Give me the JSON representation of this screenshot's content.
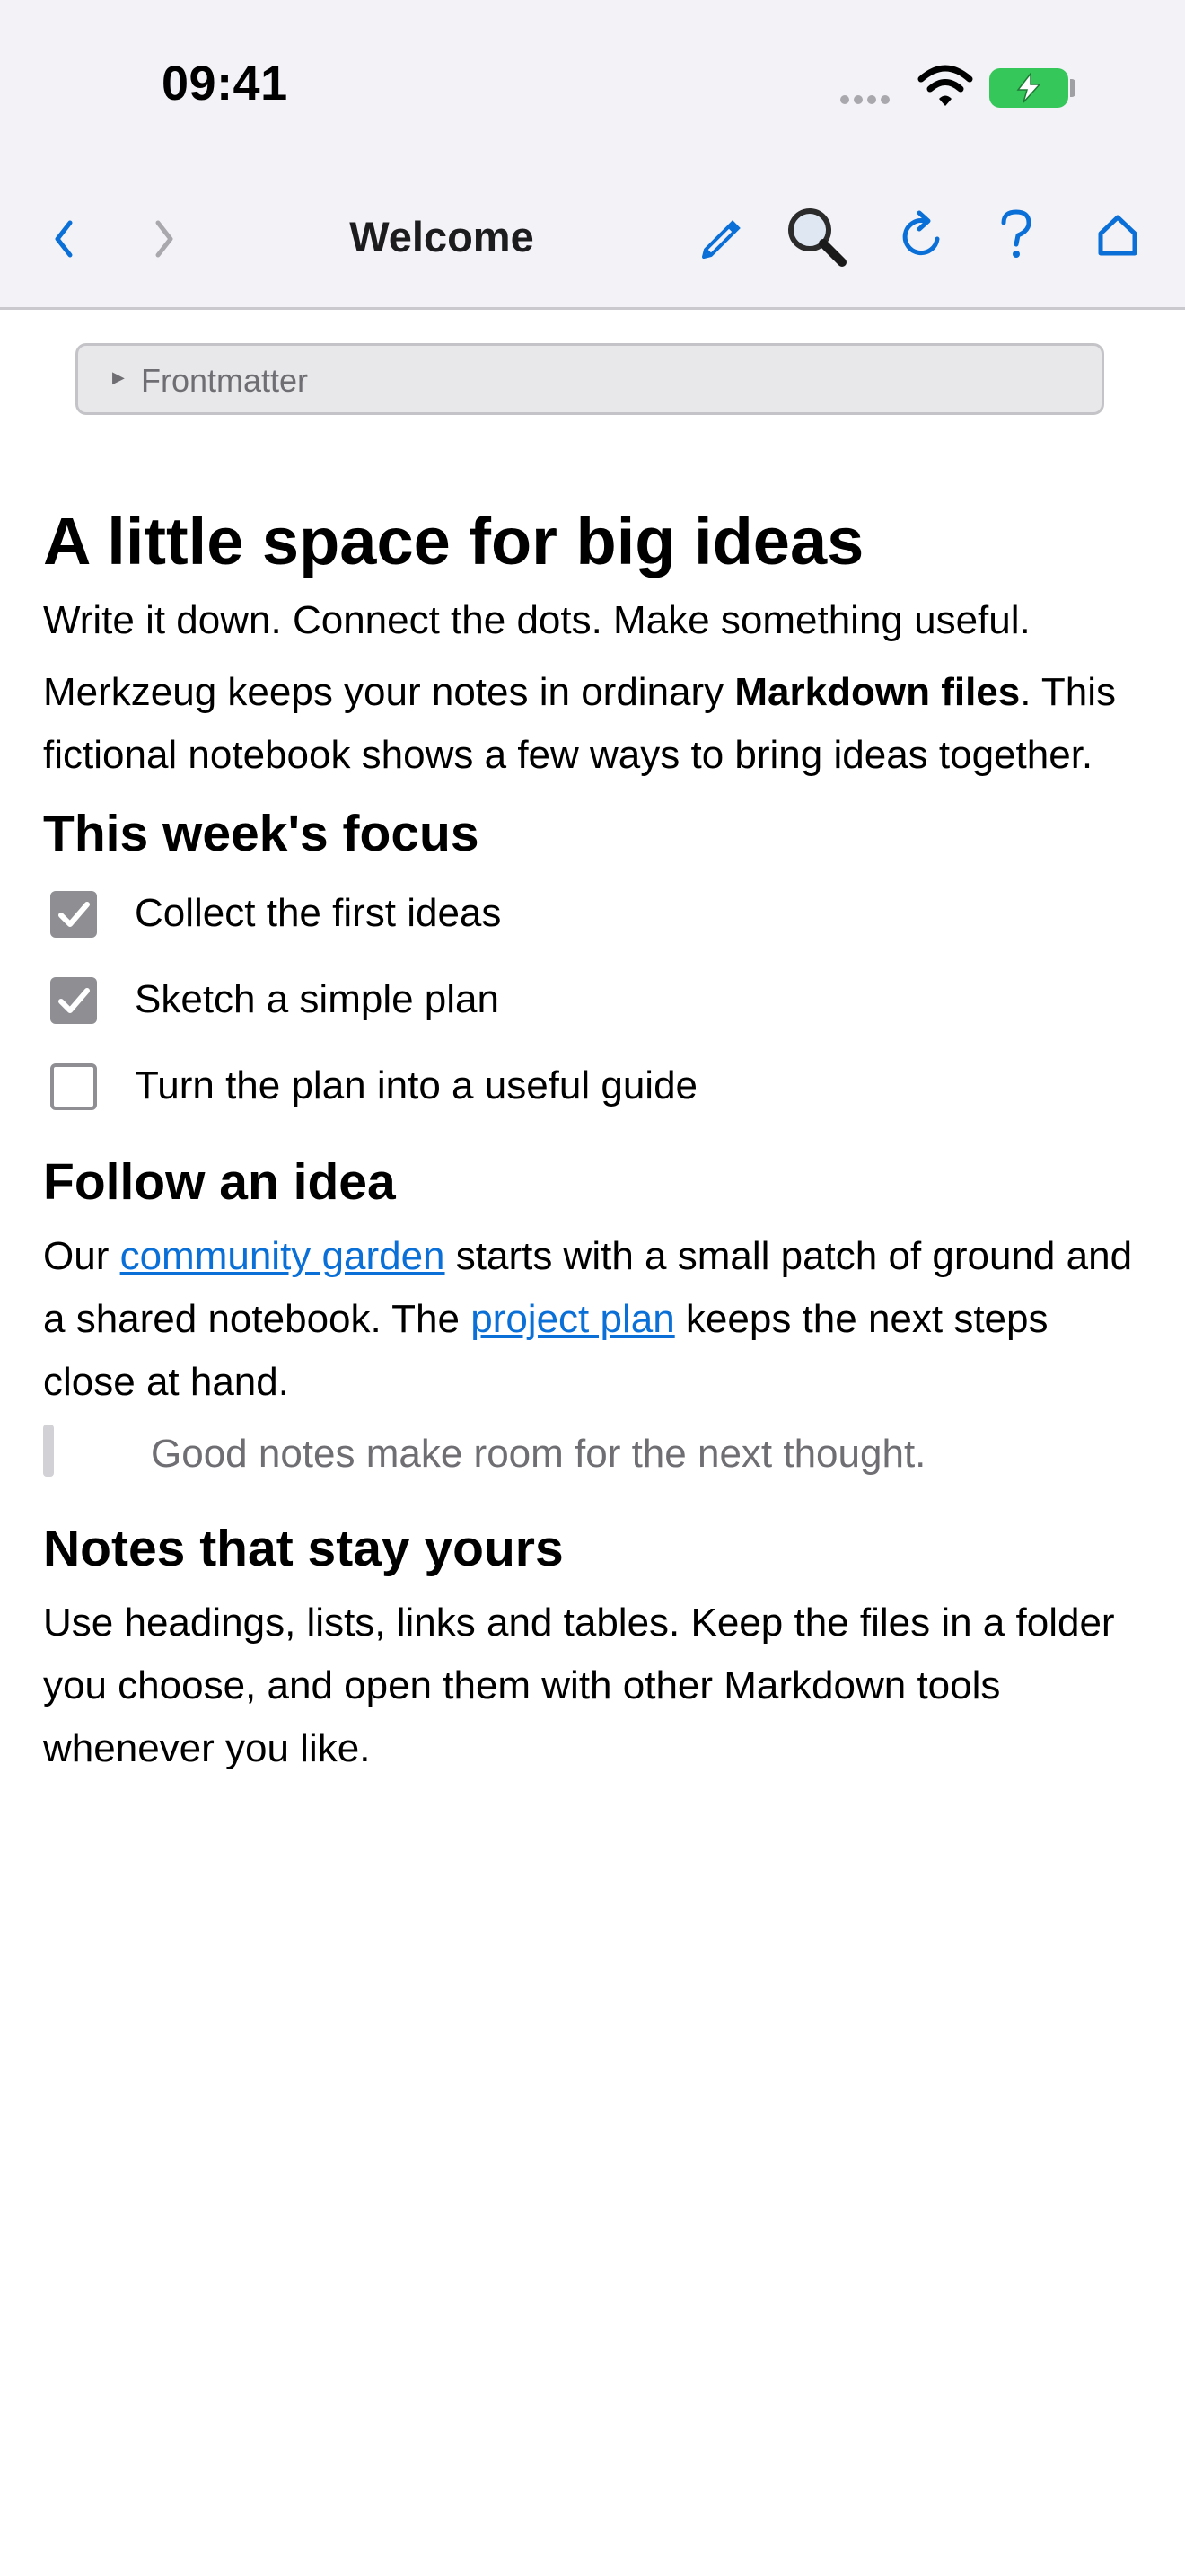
{
  "status_bar": {
    "time": "09:41"
  },
  "nav": {
    "title": "Welcome",
    "icons": [
      "chevron-left-icon",
      "chevron-right-icon",
      "pencil-icon",
      "magnifier-icon",
      "reload-icon",
      "help-icon",
      "home-icon"
    ]
  },
  "frontmatter": {
    "label": "Frontmatter"
  },
  "doc": {
    "title": "A little space for big ideas",
    "intro1": "Write it down. Connect the dots. Make something useful.",
    "intro2_pre": "Merkzeug keeps your notes in ordinary ",
    "intro2_bold": "Markdown files",
    "intro2_post": ". This fictional notebook shows a few ways to bring ideas together.",
    "focus_heading": "This week's focus",
    "tasks": [
      {
        "label": "Collect the first ideas",
        "done": true
      },
      {
        "label": "Sketch a simple plan",
        "done": true
      },
      {
        "label": "Turn the plan into a useful guide",
        "done": false
      }
    ],
    "follow_heading": "Follow an idea",
    "follow_p1": "Our ",
    "follow_link1": "community garden",
    "follow_p2": " starts with a small patch of ground and a shared notebook. The ",
    "follow_link2": "project plan",
    "follow_p3": " keeps the next steps close at hand.",
    "quote": "Good notes make room for the next thought.",
    "yours_heading": "Notes that stay yours",
    "yours_body": "Use headings, lists, links and tables. Keep the files in a folder you choose, and open them with other Markdown tools whenever you like."
  },
  "colors": {
    "accent": "#0a6fd6",
    "battery": "#35c759",
    "checkbox": "#8e8e93"
  }
}
